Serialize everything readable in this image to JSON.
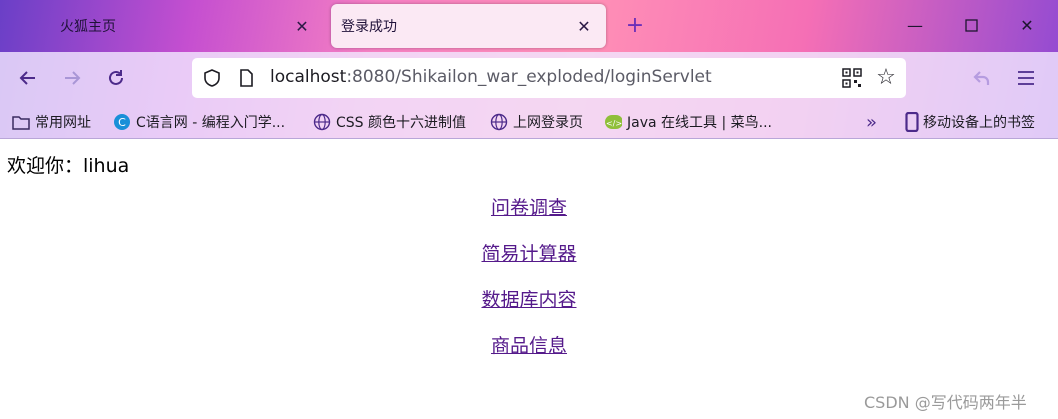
{
  "tabs": [
    {
      "title": "火狐主页",
      "active": false
    },
    {
      "title": "登录成功",
      "active": true
    }
  ],
  "toolbar": {
    "url_host": "localhost",
    "url_rest": ":8080/Shikailon_war_exploded/loginServlet"
  },
  "bookmarks": [
    {
      "label": "常用网址",
      "icon": "folder-icon"
    },
    {
      "label": "C语言网 - 编程入门学...",
      "icon": "c-site-icon"
    },
    {
      "label": "CSS 颜色十六进制值",
      "icon": "globe-icon"
    },
    {
      "label": "上网登录页",
      "icon": "globe-icon"
    },
    {
      "label": "Java 在线工具 | 菜鸟...",
      "icon": "runoob-icon"
    },
    {
      "label": "移动设备上的书签",
      "icon": "mobile-icon"
    }
  ],
  "page": {
    "welcome": "欢迎你：lihua",
    "links": [
      "问卷调查",
      "简易计算器",
      "数据库内容",
      "商品信息"
    ]
  },
  "watermark": "CSDN @写代码两年半",
  "colors": {
    "accent": "#6b2fb8",
    "visited_link": "#551a8b"
  }
}
